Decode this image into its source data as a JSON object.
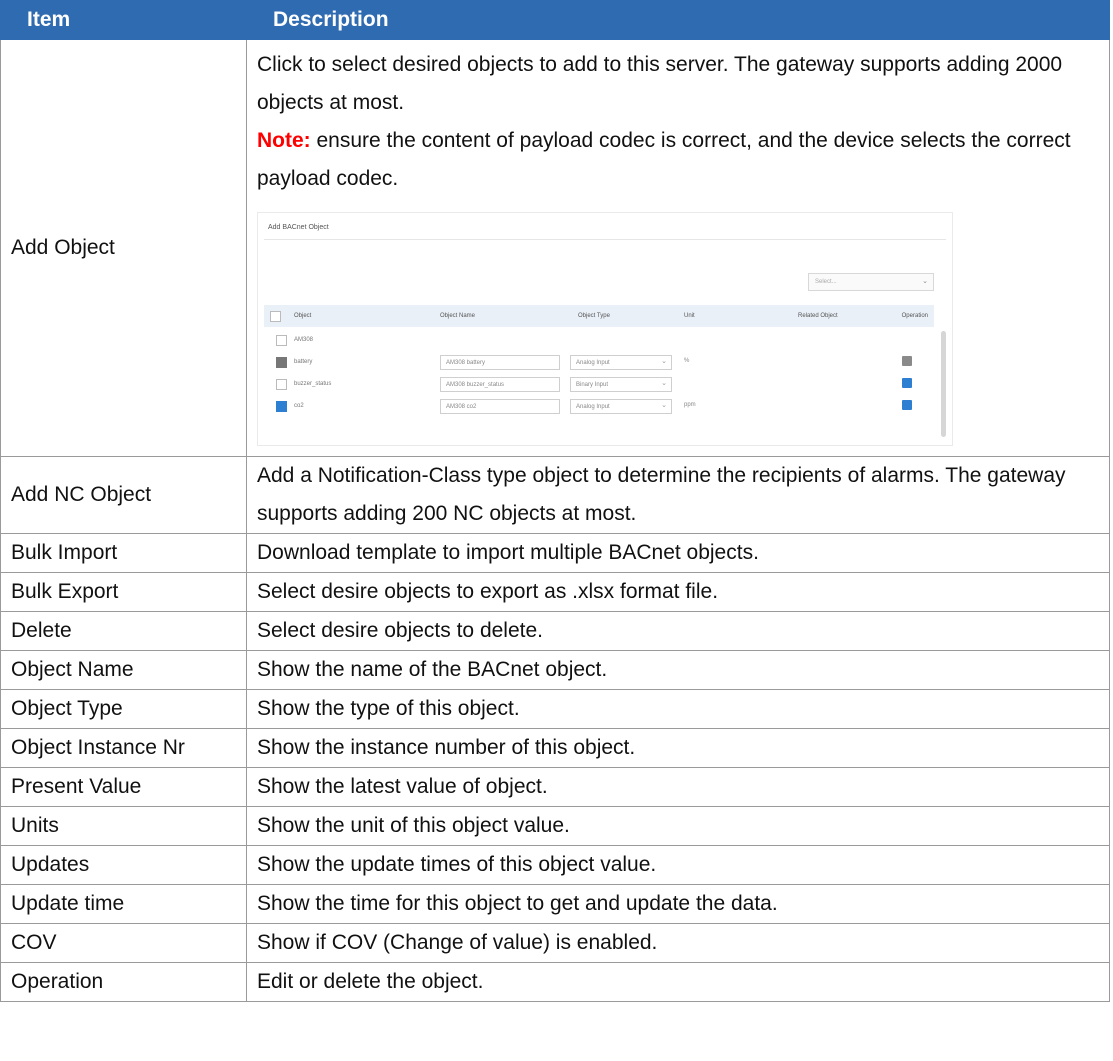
{
  "header": {
    "item": "Item",
    "description": "Description"
  },
  "add_object": {
    "item": "Add Object",
    "desc_line1": "Click to select desired objects to add to this server. The gateway supports adding 2000 objects at most.",
    "note_label": "Note:",
    "note_text": " ensure the content of payload codec is correct, and the device selects the correct payload codec.",
    "screenshot": {
      "title": "Add BACnet Object",
      "search_placeholder": "Select...",
      "columns": [
        "Object",
        "Object Name",
        "Object Type",
        "Unit",
        "Related Object",
        "Operation"
      ],
      "rows": [
        {
          "name": "AM308",
          "checked": false,
          "object_name": "",
          "object_type": "",
          "unit": "",
          "kind": "group"
        },
        {
          "name": "battery",
          "checked": "dark",
          "object_name": "AM308 battery",
          "object_type": "Analog Input",
          "unit": "%",
          "kind": "row"
        },
        {
          "name": "buzzer_status",
          "checked": false,
          "object_name": "AM308 buzzer_status",
          "object_type": "Binary Input",
          "unit": "",
          "kind": "row"
        },
        {
          "name": "co2",
          "checked": true,
          "object_name": "AM308 co2",
          "object_type": "Analog Input",
          "unit": "ppm",
          "kind": "row"
        }
      ]
    }
  },
  "rows": [
    {
      "item": "Add NC Object",
      "description": "Add a Notification-Class type object to determine the recipients of alarms. The gateway supports adding 200 NC objects at most."
    },
    {
      "item": "Bulk Import",
      "description": "Download template to import multiple BACnet objects."
    },
    {
      "item": "Bulk Export",
      "description": "Select desire objects to export as .xlsx format file."
    },
    {
      "item": "Delete",
      "description": "Select desire objects to delete."
    },
    {
      "item": "Object Name",
      "description": "Show the name of the BACnet object."
    },
    {
      "item": "Object Type",
      "description": "Show the type of this object."
    },
    {
      "item": "Object Instance Nr",
      "description": "Show the instance number of this object."
    },
    {
      "item": "Present Value",
      "description": "Show the latest value of object."
    },
    {
      "item": "Units",
      "description": "Show the unit of this object value."
    },
    {
      "item": "Updates",
      "description": "Show the update times of this object value."
    },
    {
      "item": "Update time",
      "description": "Show the time for this object to get and update the data."
    },
    {
      "item": "COV",
      "description": "Show if COV (Change of value) is enabled."
    },
    {
      "item": "Operation",
      "description": "Edit or delete the object."
    }
  ],
  "colors": {
    "header_bg": "#2f6bb0",
    "note": "#ff0000",
    "check": "#2d7fd1"
  }
}
